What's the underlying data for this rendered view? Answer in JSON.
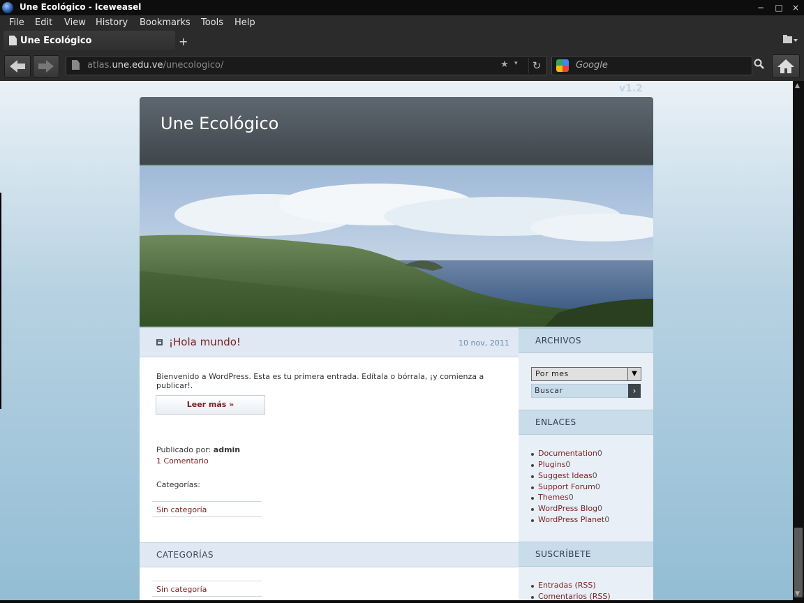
{
  "window": {
    "title": "Une Ecológico - Iceweasel",
    "controls": [
      "−",
      "□",
      "×"
    ]
  },
  "menu": [
    "File",
    "Edit",
    "View",
    "History",
    "Bookmarks",
    "Tools",
    "Help"
  ],
  "tab": {
    "label": "Une Ecológico",
    "new_tab": "+"
  },
  "navbar": {
    "back": "◀",
    "forward": "▶",
    "url_prefix": "atlas.",
    "url_host": "une.edu.ve",
    "url_path": "/unecologico/",
    "star": "★",
    "dropdown": "▾",
    "reload": "↻",
    "search_placeholder": "Google",
    "search_go": "⚲",
    "home": "⌂"
  },
  "page": {
    "version": "v1.2",
    "site_title": "Une Ecológico",
    "post": {
      "title": "¡Hola mundo!",
      "date": "10 nov, 2011",
      "body": "Bienvenido a WordPress. Esta es tu primera entrada. Edítala o bórrala, ¡y comienza a publicar!.",
      "read_more": "Leer más »",
      "byline_label": "Publicado por:",
      "author": "admin",
      "comments": "1 Comentario",
      "categories_label": "Categorías:",
      "category": "Sin categoría"
    },
    "categories_section": {
      "heading": "CATEGORÍAS",
      "item": "Sin categoría"
    },
    "sidebar": {
      "archivos": {
        "heading": "ARCHIVOS",
        "select_value": "Por mes",
        "search_value": "Buscar",
        "search_btn": "›"
      },
      "enlaces": {
        "heading": "ENLACES",
        "links": [
          {
            "label": "Documentation",
            "count": "0"
          },
          {
            "label": "Plugins",
            "count": "0"
          },
          {
            "label": "Suggest Ideas",
            "count": "0"
          },
          {
            "label": "Support Forum",
            "count": "0"
          },
          {
            "label": "Themes",
            "count": "0"
          },
          {
            "label": "WordPress Blog",
            "count": "0"
          },
          {
            "label": "WordPress Planet",
            "count": "0"
          }
        ]
      },
      "suscribete": {
        "heading": "SUSCRÍBETE",
        "links": [
          "Entradas (RSS)",
          "Comentarios (RSS)"
        ]
      }
    }
  },
  "colors": {
    "link": "#7a1f1f",
    "header_bg": "#4a5158",
    "panel_bg": "#dfe8f3"
  }
}
